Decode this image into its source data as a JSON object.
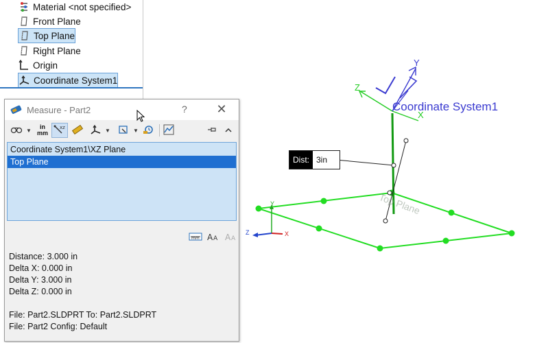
{
  "tree": {
    "items": [
      {
        "label": "Material <not specified>",
        "icon": "material-icon"
      },
      {
        "label": "Front Plane",
        "icon": "plane-icon"
      },
      {
        "label": "Top Plane",
        "icon": "plane-icon",
        "selected": true
      },
      {
        "label": "Right Plane",
        "icon": "plane-icon"
      },
      {
        "label": "Origin",
        "icon": "origin-icon"
      },
      {
        "label": "Coordinate System1",
        "icon": "coordinate-system-icon",
        "selected": true
      }
    ]
  },
  "measure": {
    "title": "Measure - Part2",
    "help": "?",
    "close": "✕",
    "toolbar": {
      "units_top": "in",
      "units_bottom": "mm"
    },
    "selections": [
      "Coordinate System1\\XZ Plane",
      "Top Plane"
    ],
    "results": {
      "distance": "Distance: 3.000 in",
      "delta_x": "Delta X: 0.000 in",
      "delta_y": "Delta Y: 3.000 in",
      "delta_z": "Delta Z: 0.000 in",
      "file": "File: Part2.SLDPRT To: Part2.SLDPRT",
      "config": "File: Part2 Config: Default"
    }
  },
  "graphics": {
    "coord_label": "Coordinate System1",
    "plane_label": "Top Plane",
    "axis_x": "X",
    "axis_y": "Y",
    "axis_z": "Z",
    "triad_y": "Y",
    "triad_x": "X",
    "triad_z": "Z",
    "dist_label": "Dist:",
    "dist_value": "3in"
  },
  "colors": {
    "plane_green": "#22dd22",
    "axis_blue": "#3a3ad0",
    "axis_green": "#22cc22",
    "selection_blue": "#1f6fd1"
  }
}
